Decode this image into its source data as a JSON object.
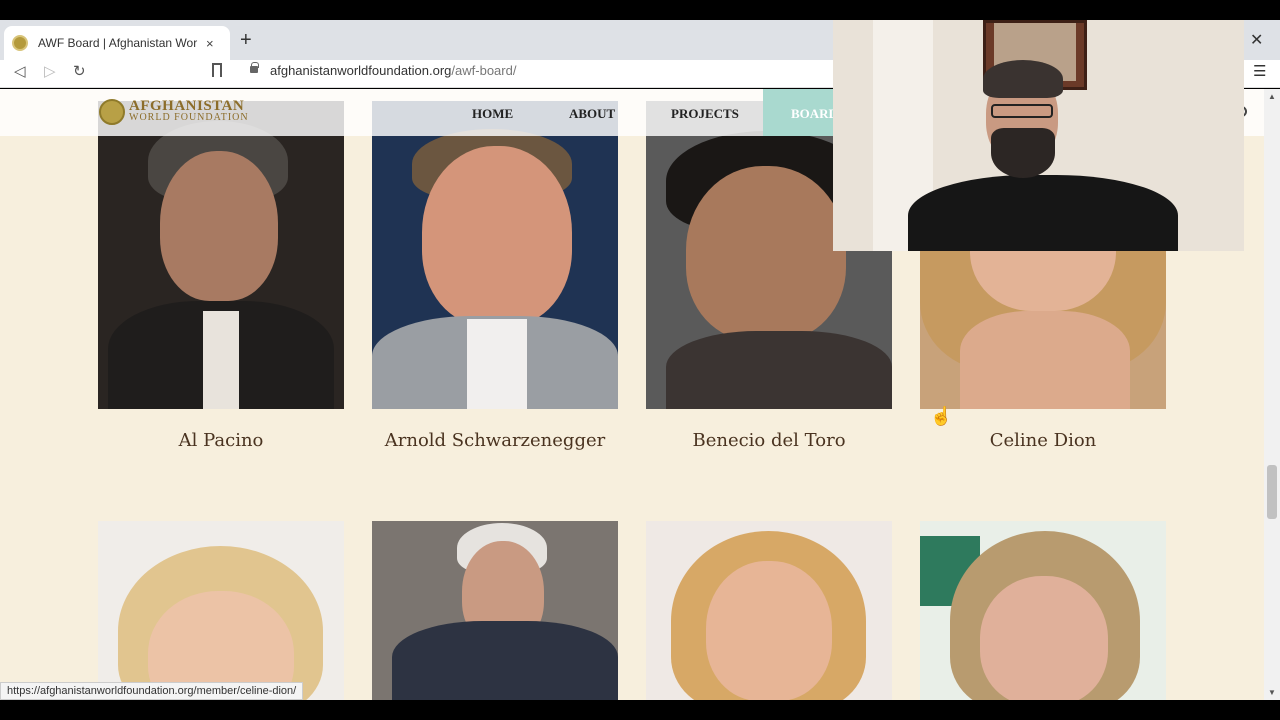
{
  "browser": {
    "tab_title": "AWF Board | Afghanistan World F",
    "tab_close": "×",
    "new_tab": "+",
    "window_close": "✕",
    "url_domain": "afghanistanworldfoundation.org",
    "url_path": "/awf-board/",
    "status_url": "https://afghanistanworldfoundation.org/member/celine-dion/"
  },
  "site": {
    "logo_line1": "AFGHANISTAN",
    "logo_line2": "WORLD FOUNDATION",
    "nav": {
      "home": "HOME",
      "about": "ABOUT",
      "projects": "PROJECTS",
      "board": "BOARD"
    }
  },
  "members_row1": [
    {
      "name": "Al Pacino"
    },
    {
      "name": "Arnold Schwarzenegger"
    },
    {
      "name": "Benecio del Toro"
    },
    {
      "name": "Celine Dion"
    }
  ],
  "colors": {
    "page_bg": "#f7efdd",
    "name_text": "#4a3320",
    "board_active": "#a9d9cf",
    "logo_gold": "#8c6d2a"
  }
}
